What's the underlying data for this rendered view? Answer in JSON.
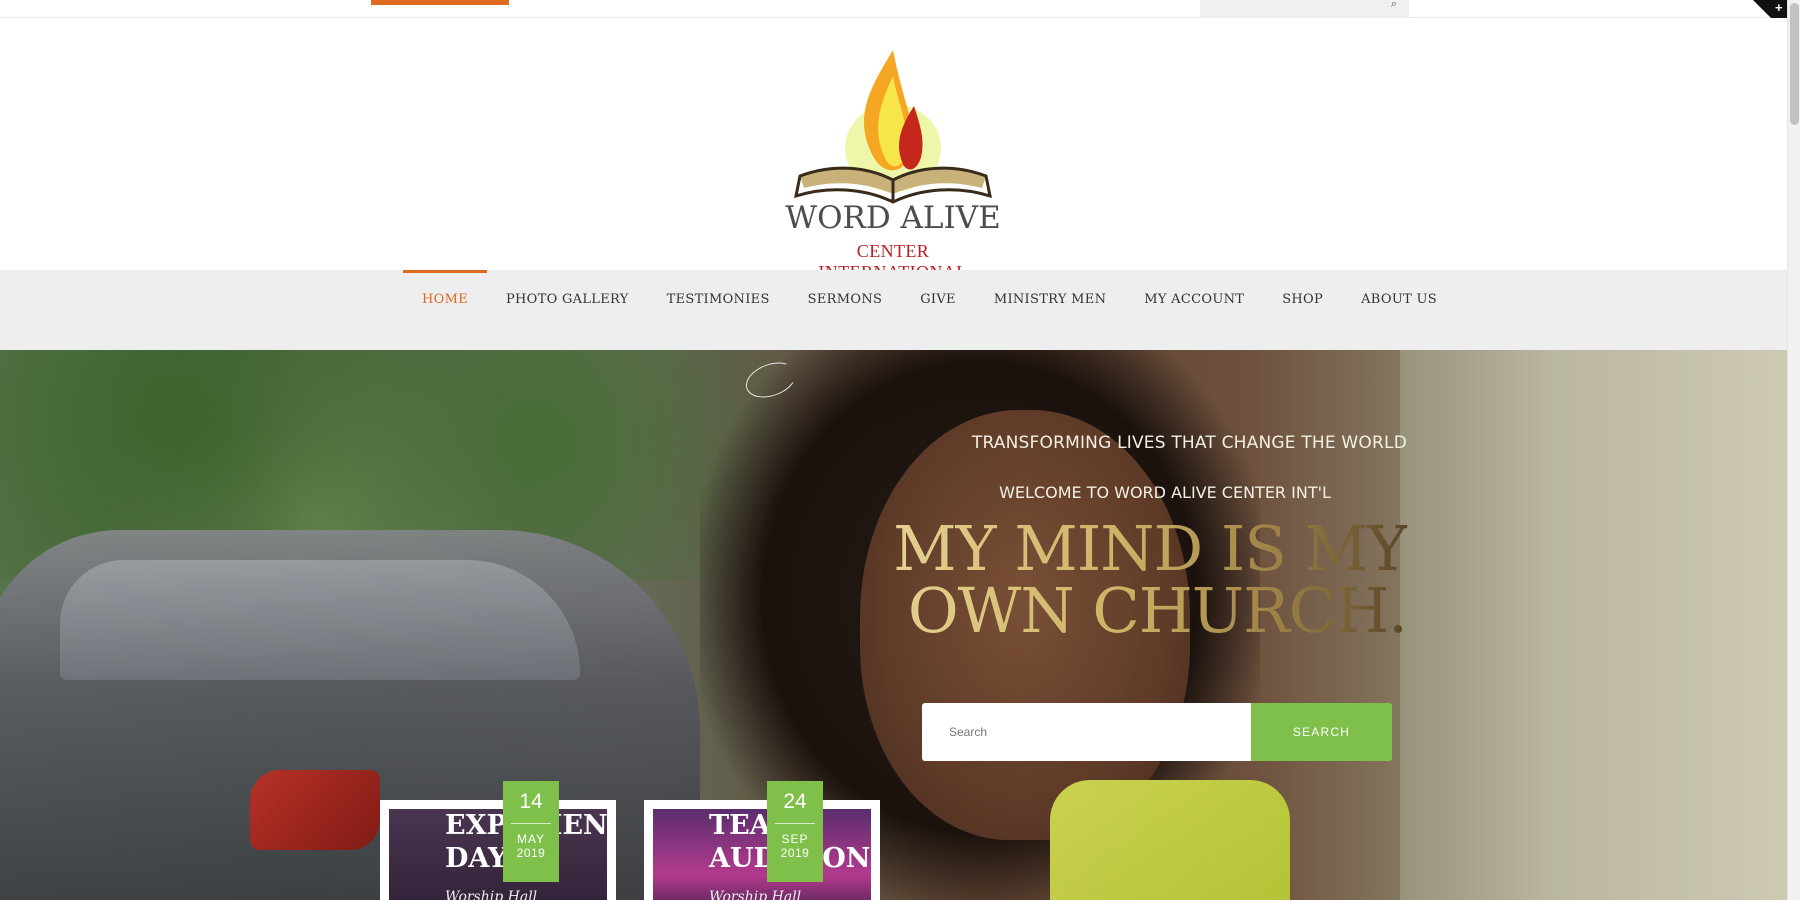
{
  "topbar": {
    "accent_color": "#e0681f",
    "search_icon": "search-icon"
  },
  "logo": {
    "name": "WORD ALIVE",
    "subtitle": "CENTER INTERNATIONAL"
  },
  "nav": {
    "items": [
      {
        "label": "HOME",
        "active": true
      },
      {
        "label": "PHOTO GALLERY"
      },
      {
        "label": "TESTIMONIES"
      },
      {
        "label": "SERMONS"
      },
      {
        "label": "GIVE"
      },
      {
        "label": "MINISTRY MEN"
      },
      {
        "label": "MY ACCOUNT"
      },
      {
        "label": "SHOP"
      },
      {
        "label": "ABOUT US"
      }
    ]
  },
  "hero": {
    "tagline": "TRANSFORMING LIVES THAT CHANGE THE WORLD",
    "welcome": "WELCOME TO WORD ALIVE CENTER  INT'L",
    "headline": "MY MIND IS MY OWN CHURCH.",
    "search": {
      "placeholder": "Search",
      "button_label": "SEARCH"
    }
  },
  "events": [
    {
      "title": "EXPERIENCE\nDAY",
      "location": "Worship Hall",
      "day": "14",
      "month": "MAY",
      "year": "2019"
    },
    {
      "title": "TEAM\nAUDITIONS",
      "location": "Worship Hall",
      "day": "24",
      "month": "SEP",
      "year": "2019"
    }
  ],
  "colors": {
    "accent_orange": "#e0681f",
    "accent_green": "#7fc04a",
    "logo_red": "#b82025"
  }
}
